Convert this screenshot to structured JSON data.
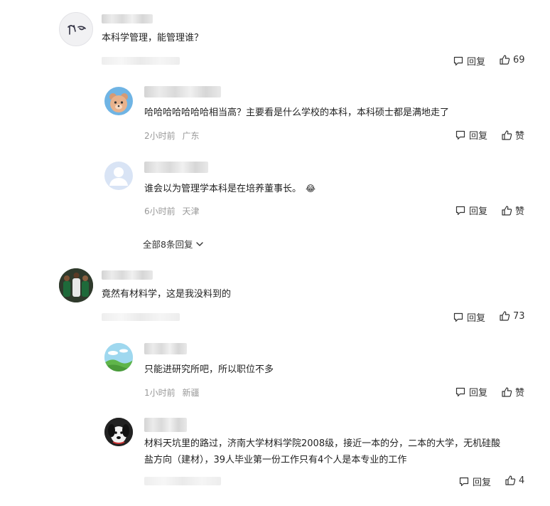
{
  "comments": [
    {
      "text": "本科学管理，能管理谁？",
      "reply_label": "回复",
      "likes": "69",
      "replies": [
        {
          "text": "哈哈哈哈哈哈哈相当高？主要看是什么学校的本科，本科硕士都是满地走了",
          "time": "2小时前",
          "location": "广东",
          "reply_label": "回复",
          "like_label": "赞"
        },
        {
          "text": "谁会以为管理学本科是在培养董事长。",
          "emoji": "😂",
          "time": "6小时前",
          "location": "天津",
          "reply_label": "回复",
          "like_label": "赞"
        }
      ],
      "more_label": "全部8条回复"
    },
    {
      "text": "竟然有材料学，这是我没料到的",
      "reply_label": "回复",
      "likes": "73",
      "replies": [
        {
          "text": "只能进研究所吧，所以职位不多",
          "time": "1小时前",
          "location": "新疆",
          "reply_label": "回复",
          "like_label": "赞"
        },
        {
          "text_line1": "材料天坑里的路过，济南大学材料学院2008级，接近一本的分，二本的大学，无机硅酸",
          "text_line2": "盐方向（建材），39人毕业第一份工作只有4个人是本专业的工作",
          "reply_label": "回复",
          "likes": "4"
        }
      ]
    }
  ],
  "colors": {
    "text": "#222222",
    "meta": "#999999",
    "action": "#333333"
  }
}
